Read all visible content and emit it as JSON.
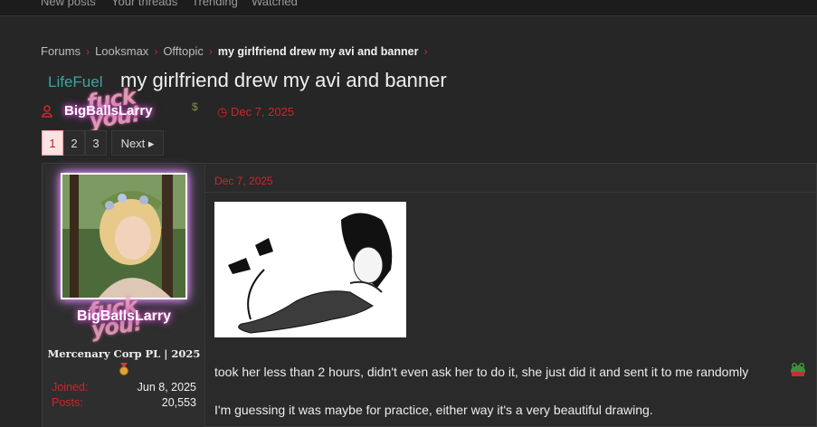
{
  "topnav": {
    "items": [
      "New posts",
      "Your threads",
      "Trending",
      "Watched"
    ]
  },
  "breadcrumb": {
    "items": [
      "Forums",
      "Looksmax",
      "Offtopic",
      "my girlfriend drew my avi and banner"
    ]
  },
  "thread": {
    "prefix": "LifeFuel",
    "title": "my girlfriend drew my avi and banner",
    "author": "BigBallsLarry",
    "author_flair": "fuck you!",
    "date": "Dec 7, 2025"
  },
  "pagination": {
    "pages": [
      "1",
      "2",
      "3"
    ],
    "active": "1",
    "next_label": "Next ▸"
  },
  "post": {
    "date": "Dec 7, 2025",
    "user": {
      "name": "BigBallsLarry",
      "flair": "fuck you!",
      "title": "Mercenary Corp PL | 2025",
      "joined_label": "Joined:",
      "joined_value": "Jun 8, 2025",
      "posts_label": "Posts:",
      "posts_value": "20,553"
    },
    "text_lines": [
      "took her less than 2 hours, didn't even ask her to do it, she just did it and sent it to me randomly",
      "I'm guessing it was maybe for practice, either way it's a very beautiful drawing."
    ]
  },
  "colors": {
    "accent": "#d3232a",
    "prefix": "#3aa6a0",
    "name_glow": "#e55ad0",
    "bg": "#262626"
  }
}
